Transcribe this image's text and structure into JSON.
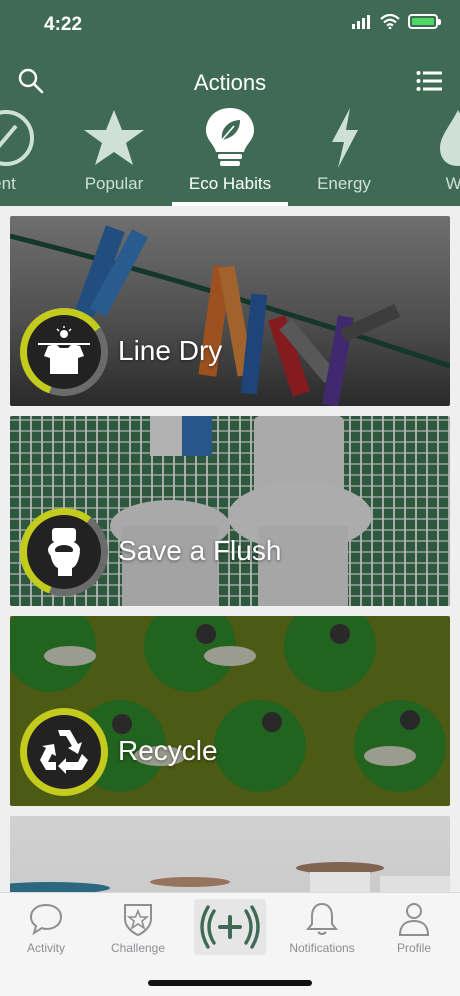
{
  "status_bar": {
    "time": "4:22"
  },
  "header": {
    "title": "Actions"
  },
  "categories": [
    {
      "label": "ent",
      "icon": "partial-circle-icon"
    },
    {
      "label": "Popular",
      "icon": "star-icon"
    },
    {
      "label": "Eco Habits",
      "icon": "lightbulb-leaf-icon",
      "active": true
    },
    {
      "label": "Energy",
      "icon": "lightning-icon"
    },
    {
      "label": "Wa",
      "icon": "water-drop-icon"
    }
  ],
  "actions": [
    {
      "label": "Line Dry",
      "icon": "shirt-sun-icon",
      "progress": 0.6
    },
    {
      "label": "Save a Flush",
      "icon": "toilet-icon",
      "progress": 0.55
    },
    {
      "label": "Recycle",
      "icon": "recycle-icon",
      "progress": 1.0
    },
    {
      "label": "",
      "icon": ""
    }
  ],
  "tabbar": {
    "activity": "Activity",
    "challenge": "Challenge",
    "notifications": "Notifications",
    "profile": "Profile"
  },
  "colors": {
    "header_bg": "#3f6b55",
    "progress_ring": "#c3cc1c",
    "accent_green": "#3f6b55"
  }
}
